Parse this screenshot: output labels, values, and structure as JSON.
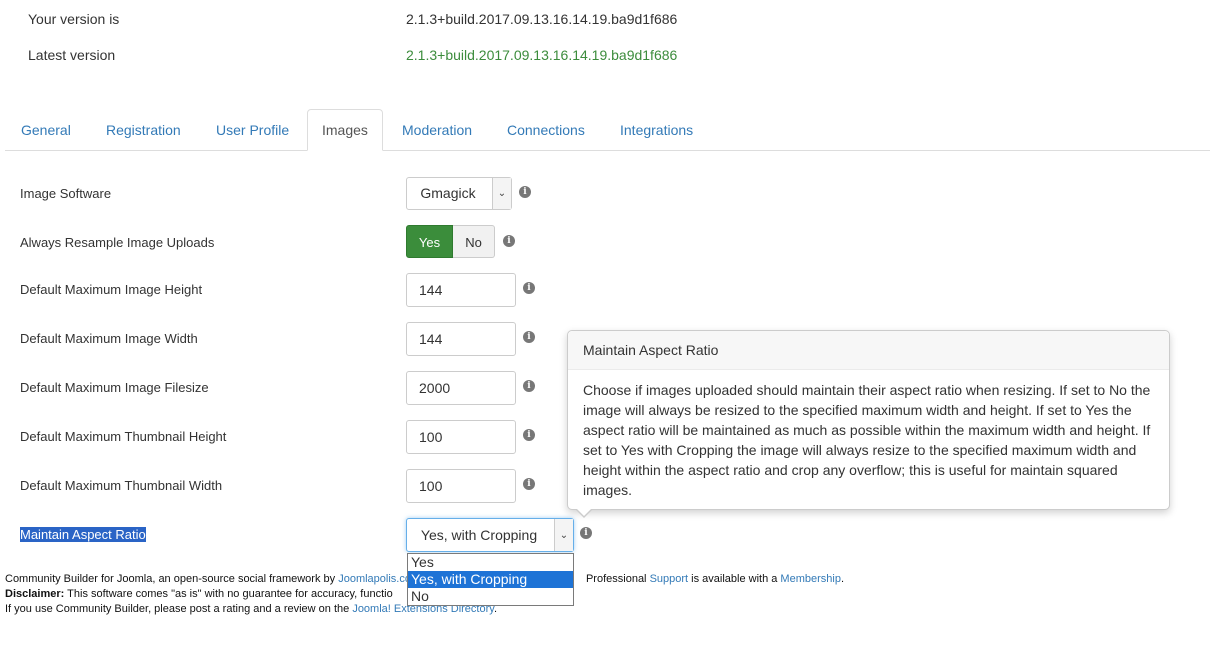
{
  "version": {
    "your_label": "Your version is",
    "your_value": "2.1.3+build.2017.09.13.16.14.19.ba9d1f686",
    "latest_label": "Latest version",
    "latest_value": "2.1.3+build.2017.09.13.16.14.19.ba9d1f686"
  },
  "tabs": [
    {
      "label": "General"
    },
    {
      "label": "Registration"
    },
    {
      "label": "User Profile"
    },
    {
      "label": "Images",
      "active": true
    },
    {
      "label": "Moderation"
    },
    {
      "label": "Connections"
    },
    {
      "label": "Integrations"
    }
  ],
  "form": {
    "image_software": {
      "label": "Image Software",
      "value": "Gmagick"
    },
    "resample": {
      "label": "Always Resample Image Uploads",
      "yes": "Yes",
      "no": "No",
      "selected": "Yes"
    },
    "max_height": {
      "label": "Default Maximum Image Height",
      "value": "144"
    },
    "max_width": {
      "label": "Default Maximum Image Width",
      "value": "144"
    },
    "max_filesize": {
      "label": "Default Maximum Image Filesize",
      "value": "2000"
    },
    "thumb_height": {
      "label": "Default Maximum Thumbnail Height",
      "value": "100"
    },
    "thumb_width": {
      "label": "Default Maximum Thumbnail Width",
      "value": "100"
    },
    "aspect": {
      "label": "Maintain Aspect Ratio",
      "value": "Yes, with Cropping",
      "options": [
        "Yes",
        "Yes, with Cropping",
        "No"
      ]
    }
  },
  "popover": {
    "title": "Maintain Aspect Ratio",
    "body": "Choose if images uploaded should maintain their aspect ratio when resizing. If set to No the image will always be resized to the specified maximum width and height. If set to Yes the aspect ratio will be maintained as much as possible within the maximum width and height. If set to Yes with Cropping the image will always resize to the specified maximum width and height within the aspect ratio and crop any overflow; this is useful for maintain squared images."
  },
  "footer": {
    "line1_a": "Community Builder for Joomla, an open-source social framework by ",
    "line1_link1": "Joomlapolis.co",
    "line1_b": "Professional ",
    "line1_link2": "Support",
    "line1_c": " is available with a ",
    "line1_link3": "Membership",
    "line1_d": ".",
    "line2_bold": "Disclaimer:",
    "line2_text": " This software comes \"as is\" with no guarantee for accuracy, functio",
    "line3_text": "If you use Community Builder, please post a rating and a review on the ",
    "line3_link": "Joomla! Extensions Directory",
    "line3_end": "."
  },
  "icons": {
    "info": "info-circle-icon",
    "arrow": "chevron-down-icon"
  },
  "colors": {
    "link": "#337ab7",
    "latest_version": "#3c8c3c",
    "yes_active": "#3b8d3b",
    "highlight": "#1e73d6"
  }
}
